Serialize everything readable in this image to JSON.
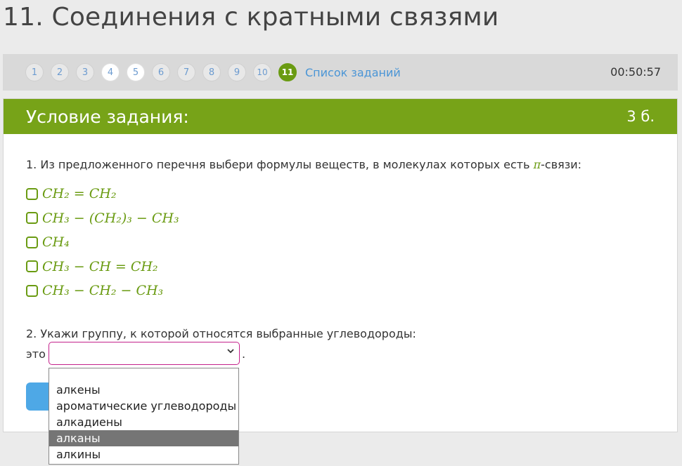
{
  "page": {
    "title": "11. Соединения с кратными связями"
  },
  "nav": {
    "pills": [
      {
        "label": "1",
        "state": "normal"
      },
      {
        "label": "2",
        "state": "normal"
      },
      {
        "label": "3",
        "state": "normal"
      },
      {
        "label": "4",
        "state": "answered"
      },
      {
        "label": "5",
        "state": "answered"
      },
      {
        "label": "6",
        "state": "normal"
      },
      {
        "label": "7",
        "state": "normal"
      },
      {
        "label": "8",
        "state": "normal"
      },
      {
        "label": "9",
        "state": "normal"
      },
      {
        "label": "10",
        "state": "normal"
      },
      {
        "label": "11",
        "state": "current"
      }
    ],
    "task_list_label": "Список заданий",
    "timer": "00:50:57"
  },
  "card": {
    "title": "Условие задания:",
    "points": "3 б."
  },
  "q1": {
    "text_before": "1. Из предложенного перечня выбери формулы веществ, в молекулах которых есть ",
    "pi": "π",
    "text_after": "-связи:",
    "options": [
      "CH₂ = CH₂",
      "CH₃ − (CH₂)₃ − CH₃",
      "CH₄",
      "CH₃ − CH = CH₂",
      "CH₃ − CH₂ − CH₃"
    ]
  },
  "q2": {
    "text": "2. Укажи группу, к которой относятся выбранные углеводороды:",
    "prefix": "это",
    "suffix": ".",
    "select_value": "",
    "dropdown_options": [
      "",
      "алкены",
      "ароматические углеводороды",
      "алкадиены",
      "алканы",
      "алкины"
    ],
    "highlighted_option": "алканы"
  },
  "colors": {
    "accent_green": "#77a318",
    "link_blue": "#4a95d6",
    "select_border": "#c4208b"
  }
}
